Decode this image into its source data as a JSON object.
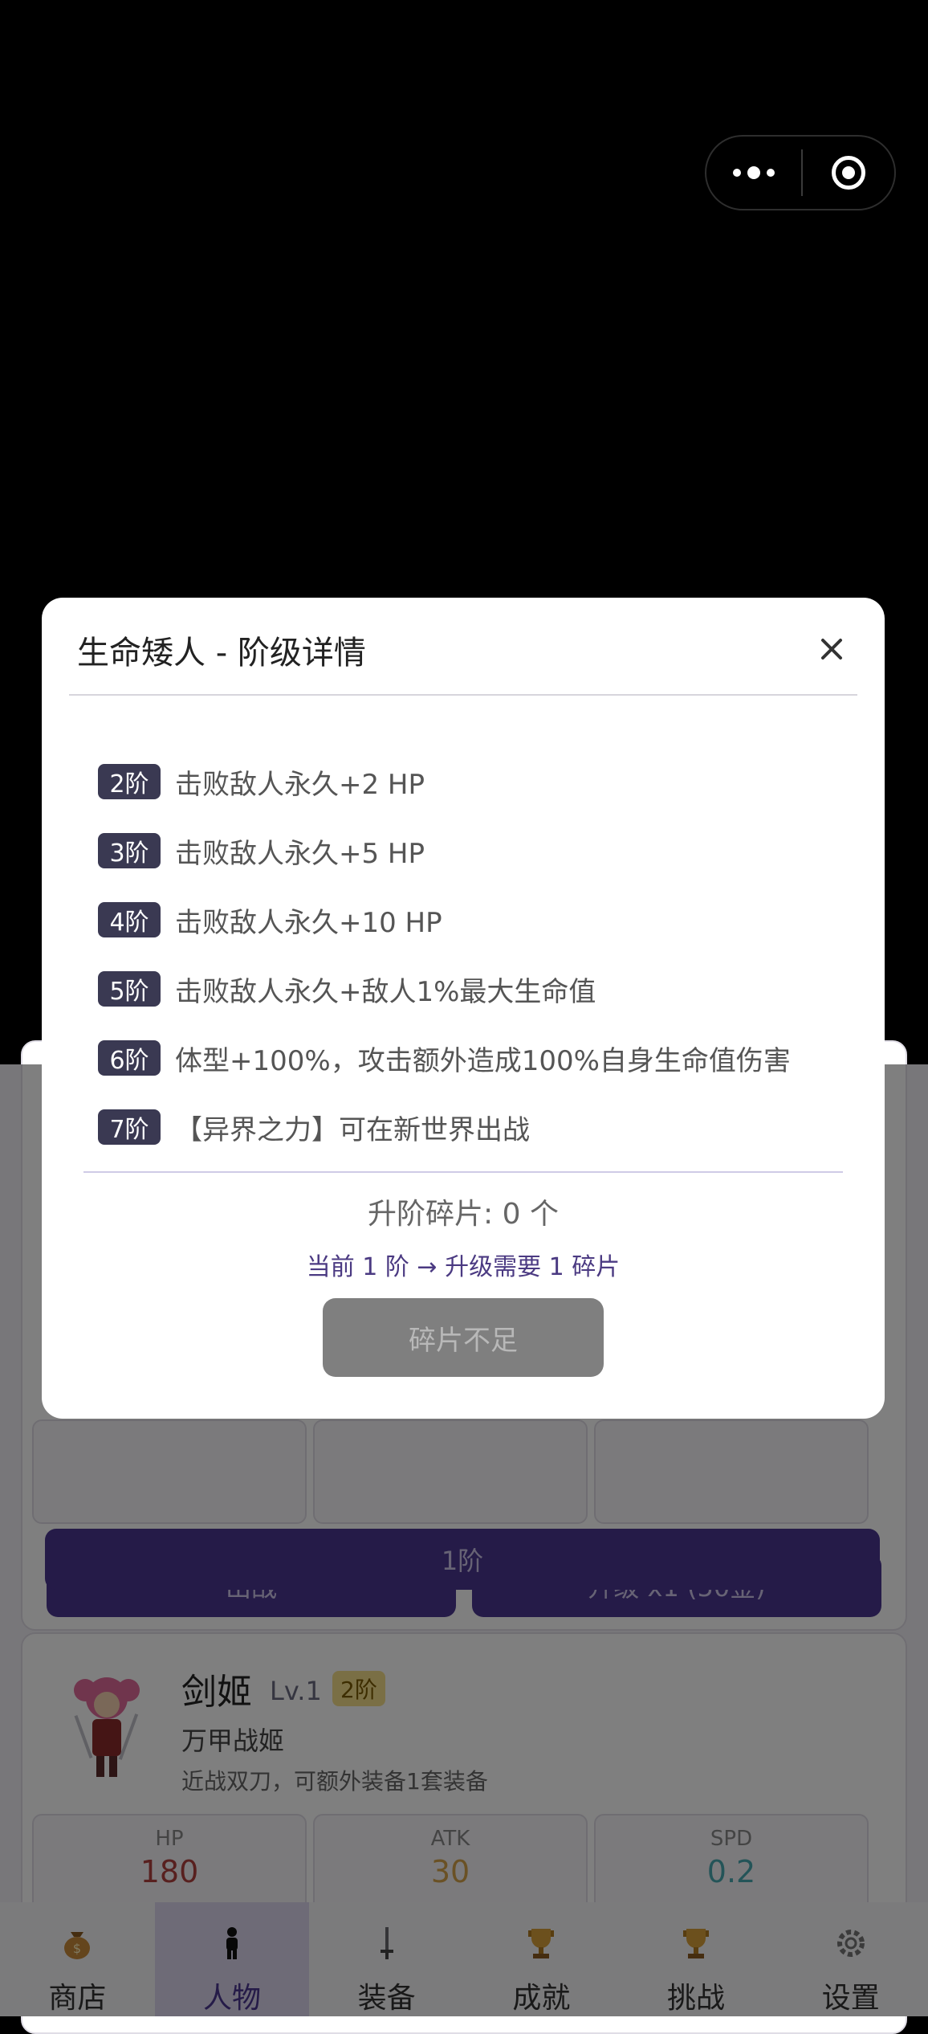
{
  "modal": {
    "title": "生命矮人 - 阶级详情",
    "tiers": [
      {
        "badge": "2阶",
        "text": "击败敌人永久+2 HP"
      },
      {
        "badge": "3阶",
        "text": "击败敌人永久+5 HP"
      },
      {
        "badge": "4阶",
        "text": "击败敌人永久+10 HP"
      },
      {
        "badge": "5阶",
        "text": "击败敌人永久+敌人1%最大生命值"
      },
      {
        "badge": "6阶",
        "text": "体型+100%，攻击额外造成100%自身生命值伤害"
      },
      {
        "badge": "7阶",
        "text": "【异界之力】可在新世界出战"
      }
    ],
    "shard_count": "升阶碎片: 0 个",
    "upgrade_info": "当前 1 阶 → 升级需要 1 碎片",
    "shard_button": "碎片不足"
  },
  "hero1": {
    "deploy_button": "出战",
    "upgrade_button": "升级 x1 (50金)",
    "tier_button": "1阶"
  },
  "hero2": {
    "name": "剑姬",
    "level": "Lv.1",
    "tier": "2阶",
    "title": "万甲战姬",
    "desc": "近战双刀，可额外装备1套装备",
    "stats": [
      {
        "label": "HP",
        "value": "180",
        "color": "#b0403e"
      },
      {
        "label": "ATK",
        "value": "30",
        "color": "#d4a24a"
      },
      {
        "label": "SPD",
        "value": "0.2",
        "color": "#48a8b0"
      }
    ]
  },
  "tabbar": [
    {
      "label": "商店",
      "icon": "money-bag-icon"
    },
    {
      "label": "人物",
      "icon": "person-icon",
      "active": true
    },
    {
      "label": "装备",
      "icon": "sword-icon"
    },
    {
      "label": "成就",
      "icon": "trophy-icon"
    },
    {
      "label": "挑战",
      "icon": "trophy-icon"
    },
    {
      "label": "设置",
      "icon": "gear-icon"
    }
  ],
  "colors": {
    "accent": "#4b3690",
    "badge": "#3a3952"
  }
}
